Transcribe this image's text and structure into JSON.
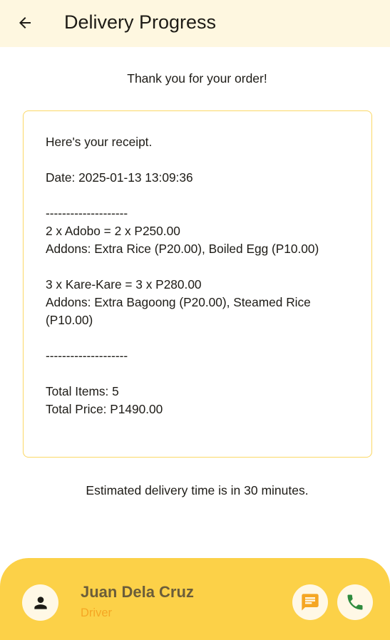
{
  "appbar": {
    "title": "Delivery Progress",
    "back_icon": "arrow-back-icon"
  },
  "main": {
    "thanks": "Thank you for your order!",
    "receipt": "Here's your receipt.\n\nDate: 2025-01-13 13:09:36\n\n--------------------\n2 x Adobo = 2 x P250.00\nAddons: Extra Rice (P20.00), Boiled Egg (P10.00)\n\n3 x Kare-Kare = 3 x P280.00\nAddons: Extra Bagoong (P20.00), Steamed Rice (P10.00)\n\n--------------------\n\nTotal Items: 5\nTotal Price: P1490.00",
    "eta": "Estimated delivery time is in 30 minutes."
  },
  "driver": {
    "name": "Juan Dela Cruz",
    "role": "Driver",
    "avatar_icon": "person-icon",
    "message_icon": "chat-icon",
    "call_icon": "phone-icon"
  },
  "colors": {
    "appbar_bg": "#fef7e0",
    "accent": "#fcd148",
    "role_text": "#f5a623",
    "call_green": "#2e8b3d",
    "message_amber": "#f5a623"
  }
}
